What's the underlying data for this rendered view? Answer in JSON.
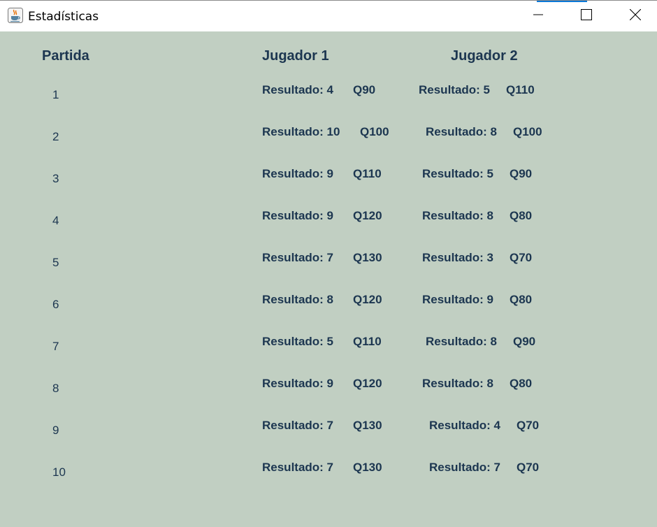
{
  "window": {
    "title": "Estadísticas",
    "controls": [
      "minimize",
      "maximize",
      "close"
    ]
  },
  "headers": {
    "partida": "Partida",
    "jugador1": "Jugador 1",
    "jugador2": "Jugador 2"
  },
  "rows": [
    {
      "partida": "1",
      "j1_result": "Resultado: 4",
      "j1_q": "Q90",
      "j2_result": "Resultado: 5",
      "j2_q": "Q110"
    },
    {
      "partida": "2",
      "j1_result": "Resultado: 10",
      "j1_q": "Q100",
      "j2_result": "Resultado: 8",
      "j2_q": "Q100"
    },
    {
      "partida": "3",
      "j1_result": "Resultado: 9",
      "j1_q": "Q110",
      "j2_result": "Resultado: 5",
      "j2_q": "Q90"
    },
    {
      "partida": "4",
      "j1_result": "Resultado: 9",
      "j1_q": "Q120",
      "j2_result": "Resultado: 8",
      "j2_q": "Q80"
    },
    {
      "partida": "5",
      "j1_result": "Resultado: 7",
      "j1_q": "Q130",
      "j2_result": "Resultado: 3",
      "j2_q": "Q70"
    },
    {
      "partida": "6",
      "j1_result": "Resultado: 8",
      "j1_q": "Q120",
      "j2_result": "Resultado: 9",
      "j2_q": "Q80"
    },
    {
      "partida": "7",
      "j1_result": "Resultado: 5",
      "j1_q": "Q110",
      "j2_result": "Resultado: 8",
      "j2_q": "Q90"
    },
    {
      "partida": "8",
      "j1_result": "Resultado: 9",
      "j1_q": "Q120",
      "j2_result": "Resultado: 8",
      "j2_q": "Q80"
    },
    {
      "partida": "9",
      "j1_result": "Resultado: 7",
      "j1_q": "Q130",
      "j2_result": "Resultado: 4",
      "j2_q": "Q70"
    },
    {
      "partida": "10",
      "j1_result": "Resultado: 7",
      "j1_q": "Q130",
      "j2_result": "Resultado: 7",
      "j2_q": "Q70"
    }
  ],
  "colors": {
    "background": "#c1cfc2",
    "text": "#1c3650",
    "titlebar": "#ffffff",
    "accent": "#0a78d7"
  },
  "icons": {
    "app": "java-cup-icon",
    "minimize": "minimize-icon",
    "maximize": "maximize-icon",
    "close": "close-icon"
  }
}
